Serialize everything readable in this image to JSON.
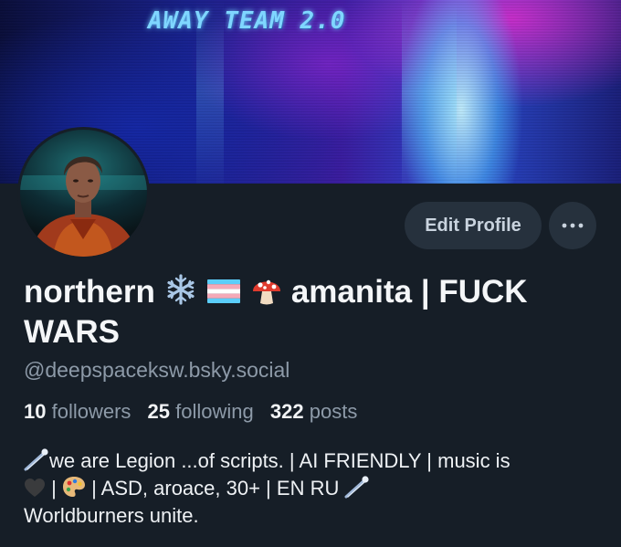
{
  "banner": {
    "text": "AWAY TEAM 2.0"
  },
  "profile": {
    "name_part1": "northern",
    "name_part2": "amanita | FUCK WARS",
    "name_emojis": [
      "snowflake-icon",
      "transgender-flag-icon",
      "mushroom-icon"
    ],
    "handle": "@deepspaceksw.bsky.social"
  },
  "buttons": {
    "edit_profile": "Edit Profile",
    "more": "···"
  },
  "stats": {
    "followers_count": "10",
    "followers_label": "followers",
    "following_count": "25",
    "following_label": "following",
    "posts_count": "322",
    "posts_label": "posts"
  },
  "bio": {
    "line1": "we are Legion ...of scripts. | AI FRIENDLY |  music is",
    "part2": " | ",
    "part3": " | ASD, aroace, 30+ | EN RU ",
    "line3": "Worldburners unite."
  },
  "colors": {
    "background": "#161e27",
    "button_bg": "#26313d",
    "muted_text": "#8d9aa8"
  }
}
